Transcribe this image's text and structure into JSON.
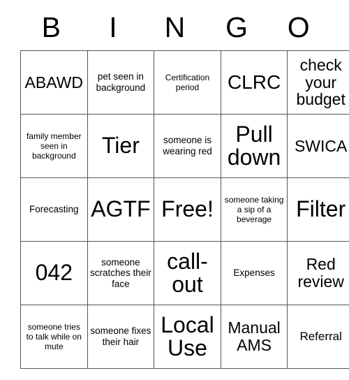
{
  "card": {
    "header_letters": [
      "B",
      "I",
      "N",
      "G",
      "O"
    ],
    "rows": [
      [
        {
          "text": "ABAWD",
          "size": "lg"
        },
        {
          "text": "pet seen in background",
          "size": "sm"
        },
        {
          "text": "Certification period",
          "size": "xs"
        },
        {
          "text": "CLRC",
          "size": "xl"
        },
        {
          "text": "check your budget",
          "size": "lg"
        }
      ],
      [
        {
          "text": "family member seen in background",
          "size": "xs"
        },
        {
          "text": "Tier",
          "size": "xxl"
        },
        {
          "text": "someone is wearing red",
          "size": "sm"
        },
        {
          "text": "Pull down",
          "size": "xxl"
        },
        {
          "text": "SWICA",
          "size": "lg"
        }
      ],
      [
        {
          "text": "Forecasting",
          "size": "sm"
        },
        {
          "text": "AGTF",
          "size": "xxl"
        },
        {
          "text": "Free!",
          "size": "xxl"
        },
        {
          "text": "someone taking a sip of a beverage",
          "size": "xs"
        },
        {
          "text": "Filter",
          "size": "xxl"
        }
      ],
      [
        {
          "text": "042",
          "size": "xxl"
        },
        {
          "text": "someone scratches their face",
          "size": "sm"
        },
        {
          "text": "call-out",
          "size": "xxl"
        },
        {
          "text": "Expenses",
          "size": "sm"
        },
        {
          "text": "Red review",
          "size": "lg"
        }
      ],
      [
        {
          "text": "someone tries to talk while on mute",
          "size": "xs"
        },
        {
          "text": "someone fixes their hair",
          "size": "sm"
        },
        {
          "text": "Local Use",
          "size": "xxl"
        },
        {
          "text": "Manual AMS",
          "size": "lg"
        },
        {
          "text": "Referral",
          "size": "md"
        }
      ]
    ]
  },
  "colors": {
    "background": "#ffffff",
    "text": "#000000",
    "border": "#555555"
  }
}
